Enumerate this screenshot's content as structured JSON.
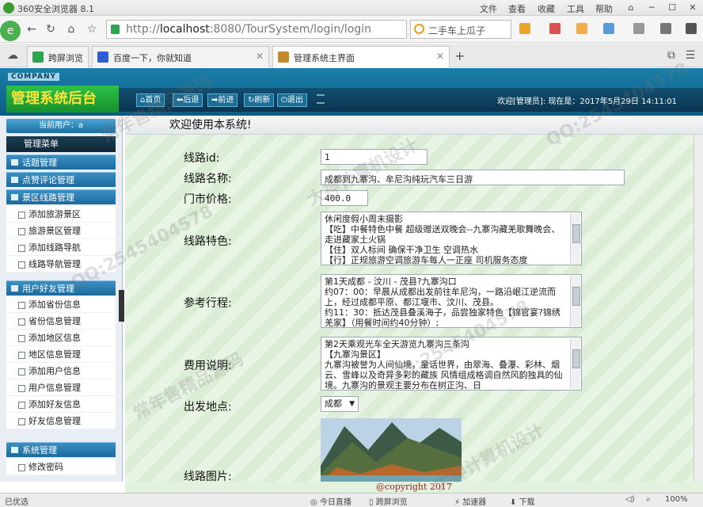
{
  "browser": {
    "title": "360安全浏览器 8.1",
    "menu": [
      "文件",
      "查看",
      "收藏",
      "工具",
      "帮助"
    ],
    "url_host": "localhost",
    "url_rest": ":8080/TourSystem/login/login",
    "url_prefix": "http://",
    "search_text": "二手车上瓜子",
    "tabs": [
      {
        "label": "跨屏浏览"
      },
      {
        "label": "百度一下，你就知道"
      },
      {
        "label": "管理系统主界面"
      }
    ],
    "add_tab": "+"
  },
  "header": {
    "company": "COMPANY",
    "system_title": "管理系统后台",
    "toolbar": [
      {
        "label": "首页"
      },
      {
        "label": "后退"
      },
      {
        "label": "前进"
      },
      {
        "label": "刷新"
      },
      {
        "label": "退出"
      }
    ],
    "welcome_text": "欢迎[管理员]: 现在是：2017年5月29日 14:11:01"
  },
  "sidebar": {
    "current_user": "当前用户：a",
    "main_menu": "管理菜单",
    "groups": [
      {
        "label": "话题管理",
        "items": []
      },
      {
        "label": "点赞评论管理",
        "items": []
      },
      {
        "label": "景区线路管理",
        "items": [
          "添加旅游景区",
          "旅游景区管理",
          "添加线路导航",
          "线路导航管理"
        ]
      },
      {
        "label": "用户好友管理",
        "items": [
          "添加省份信息",
          "省份信息管理",
          "添加地区信息",
          "地区信息管理",
          "添加用户信息",
          "用户信息管理",
          "添加好友信息",
          "好友信息管理"
        ]
      },
      {
        "label": "系统管理",
        "items": [
          "修改密码"
        ]
      }
    ]
  },
  "content": {
    "welcome": "欢迎使用本系统!",
    "fields": {
      "route_id": {
        "label": "线路id:",
        "value": "1"
      },
      "route_name": {
        "label": "线路名称:",
        "value": "成都到九寨沟、牟尼沟纯玩汽车三日游"
      },
      "price": {
        "label": "门市价格:",
        "value": "400.0"
      },
      "features": {
        "label": "线路特色:",
        "lines": [
          "休闲度假小周末摄影",
          "【吃】中餐特色中餐 超级赠送双晚会--九寨沟藏羌歌舞晚会、走进藏家土火锅",
          "【住】双人标间 确保干净卫生 空调热水",
          "【行】正规旅游空调旅游车每人一正座 司机服务态度"
        ]
      },
      "itinerary": {
        "label": "参考行程:",
        "lines": [
          "第1天成都 - 汶川 - 茂县?九寨沟口",
          "约07：00：早晨从成都出发前往牟尼沟，一路沿岷江逆流而上，经过成都平原、都江堰市、汶川、茂县。",
          "约11：30：抵达茂县叠溪海子，品尝独家特色【锦官宴?锦绣羌家】（用餐时间约40分钟）;"
        ]
      },
      "fee": {
        "label": "费用说明:",
        "lines": [
          "第2天乘观光车全天游览九寨沟三条沟",
          "【九寨沟景区】",
          "九寨沟被誉为人间仙境，童话世界，由翠海、叠瀑、彩林、烟云、雪峰以及奇异多彩的藏族 风情组成格调自然风韵独具的仙境。九寨沟的景观主要分布在树正沟、日"
        ]
      },
      "departure": {
        "label": "出发地点:",
        "value": "成都"
      },
      "image": {
        "label": "线路图片:"
      }
    },
    "footer": "@copyright 2017"
  },
  "statusbar": {
    "left": "已优选",
    "items": [
      "今日直播",
      "跨屏浏览",
      "加速器",
      "下载"
    ],
    "zoom": "100%"
  },
  "watermark": {
    "qq": "QQ:2545404578",
    "text1": "常年售精品源码",
    "text2": "大神计算机设计"
  }
}
